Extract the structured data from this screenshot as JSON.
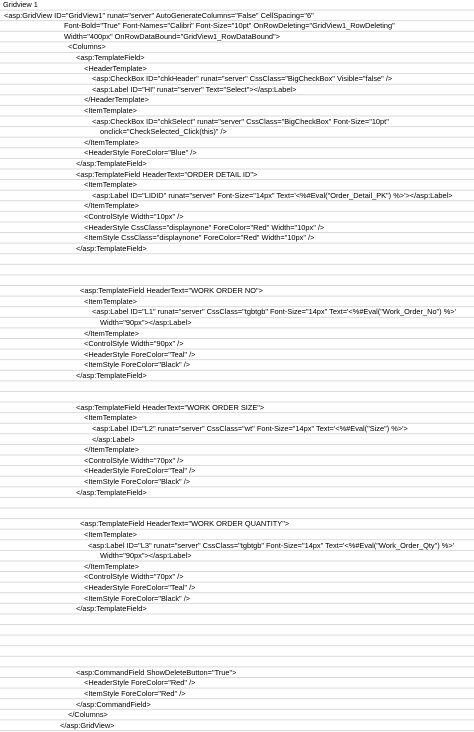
{
  "sheet": {
    "title": "Gridview 1",
    "lines": [
      {
        "row": 1,
        "indent": 4,
        "text": "<asp:GridView ID=\"GridView1\" runat=\"server\" AutoGenerateColumns=\"False\" CellSpacing=\"6\""
      },
      {
        "row": 2,
        "indent": 64,
        "text": "Font-Bold=\"True\" Font-Names=\"Calibri\" Font-Size=\"10pt\" OnRowDeleting=\"GridView1_RowDeleting\""
      },
      {
        "row": 3,
        "indent": 64,
        "text": "Width=\"400px\" OnRowDataBound=\"GridView1_RowDataBound\">"
      },
      {
        "row": 4,
        "indent": 68,
        "text": "<Columns>"
      },
      {
        "row": 5,
        "indent": 76,
        "text": "<asp:TemplateField>"
      },
      {
        "row": 6,
        "indent": 84,
        "text": "<HeaderTemplate>"
      },
      {
        "row": 7,
        "indent": 92,
        "text": "<asp:CheckBox ID=\"chkHeader\" runat=\"server\" CssClass=\"BigCheckBox\" Visible=\"false\" />"
      },
      {
        "row": 8,
        "indent": 92,
        "text": "<asp:Label ID=\"HI\" runat=\"server\" Text=\"Select\"></asp:Label>"
      },
      {
        "row": 9,
        "indent": 84,
        "text": "</HeaderTemplate>"
      },
      {
        "row": 10,
        "indent": 84,
        "text": "<ItemTemplate>"
      },
      {
        "row": 11,
        "indent": 92,
        "text": "<asp:CheckBox ID=\"chkSelect\" runat=\"server\" CssClass=\"BigCheckBox\" Font-Size=\"10pt\""
      },
      {
        "row": 12,
        "indent": 100,
        "text": "onclick=\"CheckSelected_Click(this)\" />"
      },
      {
        "row": 13,
        "indent": 84,
        "text": "</ItemTemplate>"
      },
      {
        "row": 14,
        "indent": 84,
        "text": "<HeaderStyle ForeColor=\"Blue\" />"
      },
      {
        "row": 15,
        "indent": 76,
        "text": "</asp:TemplateField>"
      },
      {
        "row": 16,
        "indent": 76,
        "text": "<asp:TemplateField HeaderText=\"ORDER DETAIL ID\">"
      },
      {
        "row": 17,
        "indent": 84,
        "text": "<ItemTemplate>"
      },
      {
        "row": 18,
        "indent": 92,
        "text": "<asp:Label ID=\"LIDID\" runat=\"server\" Font-Size=\"14px\" Text='<%#Eval(\"Order_Detail_PK\") %>'></asp:Label>"
      },
      {
        "row": 19,
        "indent": 84,
        "text": "</ItemTemplate>"
      },
      {
        "row": 20,
        "indent": 84,
        "text": "<ControlStyle Width=\"10px\" />"
      },
      {
        "row": 21,
        "indent": 84,
        "text": "<HeaderStyle CssClass=\"displaynone\" ForeColor=\"Red\" Width=\"10px\" />"
      },
      {
        "row": 22,
        "indent": 84,
        "text": "<ItemStyle CssClass=\"displaynone\" ForeColor=\"Red\" Width=\"10px\" />"
      },
      {
        "row": 23,
        "indent": 76,
        "text": "</asp:TemplateField>"
      },
      {
        "row": 27,
        "indent": 80,
        "text": "<asp:TemplateField HeaderText=\"WORK ORDER NO\">"
      },
      {
        "row": 28,
        "indent": 84,
        "text": "<ItemTemplate>"
      },
      {
        "row": 29,
        "indent": 92,
        "text": "<asp:Label ID=\"L1\" runat=\"server\" CssClass=\"tgbtgb\" Font-Size=\"14px\" Text='<%#Eval(\"Work_Order_No\") %>'"
      },
      {
        "row": 30,
        "indent": 100,
        "text": "Width=\"90px\"></asp:Label>"
      },
      {
        "row": 31,
        "indent": 84,
        "text": "</ItemTemplate>"
      },
      {
        "row": 32,
        "indent": 84,
        "text": "<ControlStyle Width=\"90px\" />"
      },
      {
        "row": 33,
        "indent": 84,
        "text": "<HeaderStyle ForeColor=\"Teal\" />"
      },
      {
        "row": 34,
        "indent": 84,
        "text": "<ItemStyle ForeColor=\"Black\" />"
      },
      {
        "row": 35,
        "indent": 76,
        "text": "</asp:TemplateField>"
      },
      {
        "row": 38,
        "indent": 76,
        "text": "<asp:TemplateField HeaderText=\"WORK ORDER SIZE\">"
      },
      {
        "row": 39,
        "indent": 84,
        "text": "<ItemTemplate>"
      },
      {
        "row": 40,
        "indent": 92,
        "text": "<asp:Label ID=\"L2\" runat=\"server\" CssClass=\"wt\" Font-Size=\"14px\" Text='<%#Eval(\"Size\") %>'>"
      },
      {
        "row": 41,
        "indent": 92,
        "text": "</asp:Label>"
      },
      {
        "row": 42,
        "indent": 84,
        "text": "</ItemTemplate>"
      },
      {
        "row": 43,
        "indent": 84,
        "text": "<ControlStyle Width=\"70px\" />"
      },
      {
        "row": 44,
        "indent": 84,
        "text": "<HeaderStyle ForeColor=\"Teal\" />"
      },
      {
        "row": 45,
        "indent": 84,
        "text": "<ItemStyle ForeColor=\"Black\" />"
      },
      {
        "row": 46,
        "indent": 76,
        "text": "</asp:TemplateField>"
      },
      {
        "row": 49,
        "indent": 80,
        "text": "<asp:TemplateField HeaderText=\"WORK ORDER QUANTITY\">"
      },
      {
        "row": 50,
        "indent": 84,
        "text": "<ItemTemplate>"
      },
      {
        "row": 51,
        "indent": 88,
        "text": "<asp:Label ID=\"L3\" runat=\"server\" CssClass=\"tgbtgb\" Font-Size=\"14px\" Text='<%#Eval(\"Work_Order_Qty\") %>'"
      },
      {
        "row": 52,
        "indent": 100,
        "text": "Width=\"90px\"></asp:Label>"
      },
      {
        "row": 53,
        "indent": 84,
        "text": "</ItemTemplate>"
      },
      {
        "row": 54,
        "indent": 84,
        "text": "<ControlStyle Width=\"70px\" />"
      },
      {
        "row": 55,
        "indent": 84,
        "text": "<HeaderStyle ForeColor=\"Teal\" />"
      },
      {
        "row": 56,
        "indent": 84,
        "text": "<ItemStyle ForeColor=\"Black\" />"
      },
      {
        "row": 57,
        "indent": 76,
        "text": "</asp:TemplateField>"
      },
      {
        "row": 63,
        "indent": 76,
        "text": "<asp:CommandField ShowDeleteButton=\"True\">"
      },
      {
        "row": 64,
        "indent": 84,
        "text": "<HeaderStyle ForeColor=\"Red\" />"
      },
      {
        "row": 65,
        "indent": 84,
        "text": "<ItemStyle ForeColor=\"Red\" />"
      },
      {
        "row": 66,
        "indent": 76,
        "text": "</asp:CommandField>"
      },
      {
        "row": 67,
        "indent": 68,
        "text": "</Columns>"
      },
      {
        "row": 68,
        "indent": 60,
        "text": "</asp:GridView>"
      }
    ]
  }
}
